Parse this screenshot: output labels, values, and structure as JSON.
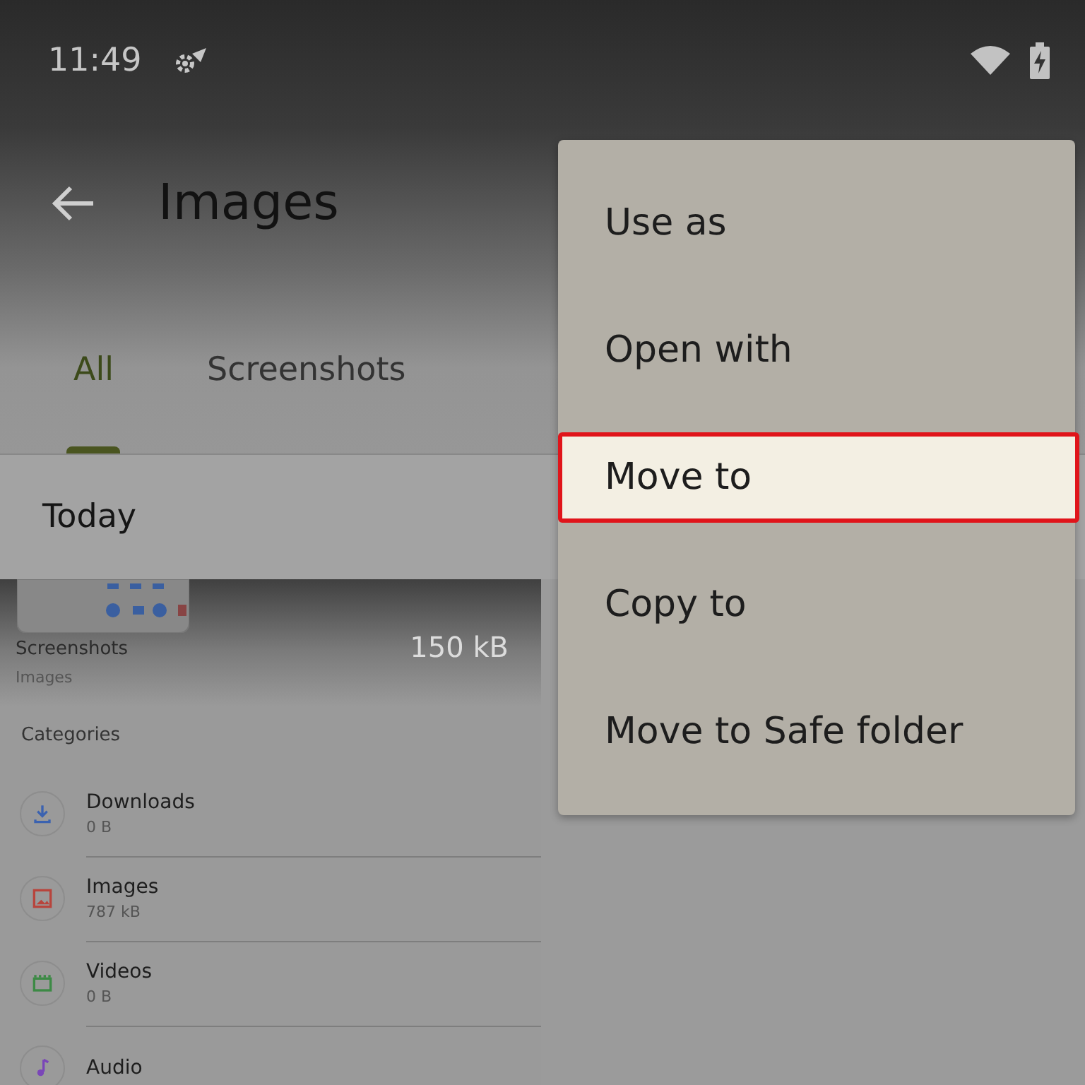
{
  "status_bar": {
    "time": "11:49"
  },
  "app_bar": {
    "title": "Images"
  },
  "tabs": [
    {
      "label": "All",
      "selected": true
    },
    {
      "label": "Screenshots",
      "selected": false
    }
  ],
  "section_header": "Today",
  "folder_card": {
    "name": "Screenshots",
    "subtitle": "Images",
    "size": "150 kB"
  },
  "categories": {
    "heading": "Categories",
    "items": [
      {
        "name": "Downloads",
        "size": "0 B",
        "kind": "downloads"
      },
      {
        "name": "Images",
        "size": "787 kB",
        "kind": "images"
      },
      {
        "name": "Videos",
        "size": "0 B",
        "kind": "videos"
      },
      {
        "name": "Audio",
        "kind": "audio"
      }
    ]
  },
  "menu": {
    "items": [
      {
        "label": "Use as",
        "selected": false
      },
      {
        "label": "Open with",
        "selected": false
      },
      {
        "label": "Move to",
        "selected": true
      },
      {
        "label": "Copy to",
        "selected": false
      },
      {
        "label": "Move to Safe folder",
        "selected": false
      }
    ]
  }
}
